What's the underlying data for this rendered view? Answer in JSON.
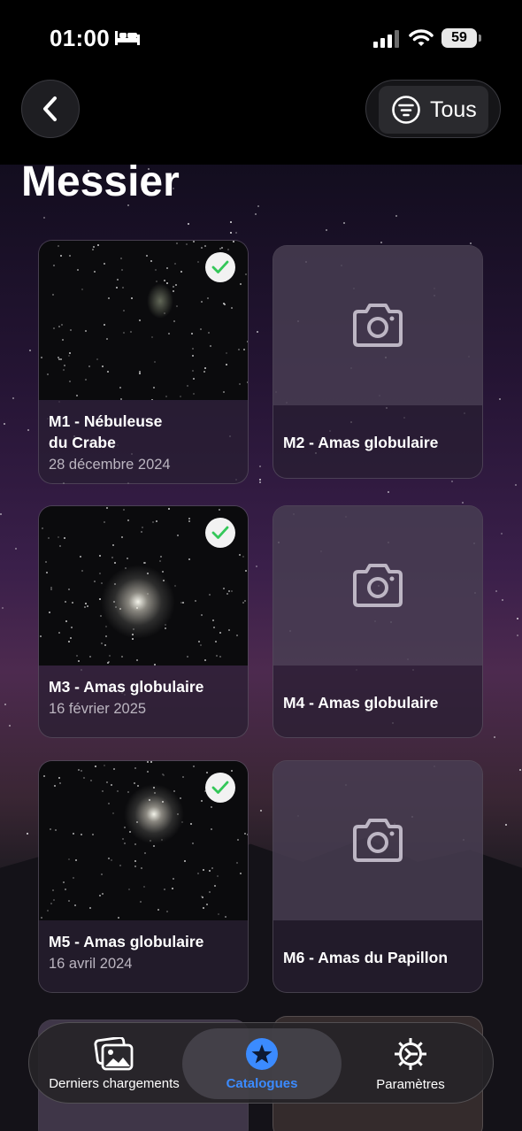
{
  "status_bar": {
    "time": "01:00",
    "battery": "59"
  },
  "nav": {
    "filter_label": "Tous"
  },
  "page": {
    "title": "Messier"
  },
  "cards": [
    {
      "title": "M1 - Nébuleuse\ndu Crabe",
      "date": "28 décembre 2024",
      "captured": true
    },
    {
      "title": "M2 - Amas globulaire",
      "date": "",
      "captured": false
    },
    {
      "title": "M3 - Amas globulaire",
      "date": "16 février 2025",
      "captured": true
    },
    {
      "title": "M4 - Amas globulaire",
      "date": "",
      "captured": false
    },
    {
      "title": "M5 - Amas globulaire",
      "date": "16 avril 2024",
      "captured": true
    },
    {
      "title": "M6 - Amas du Papillon",
      "date": "",
      "captured": false
    }
  ],
  "tabs": [
    {
      "label": "Derniers chargements",
      "icon": "photos-icon",
      "active": false
    },
    {
      "label": "Catalogues",
      "icon": "star-icon",
      "active": true
    },
    {
      "label": "Paramètres",
      "icon": "gear-icon",
      "active": false
    }
  ],
  "colors": {
    "accent": "#3b8bff",
    "check": "#34c759"
  }
}
